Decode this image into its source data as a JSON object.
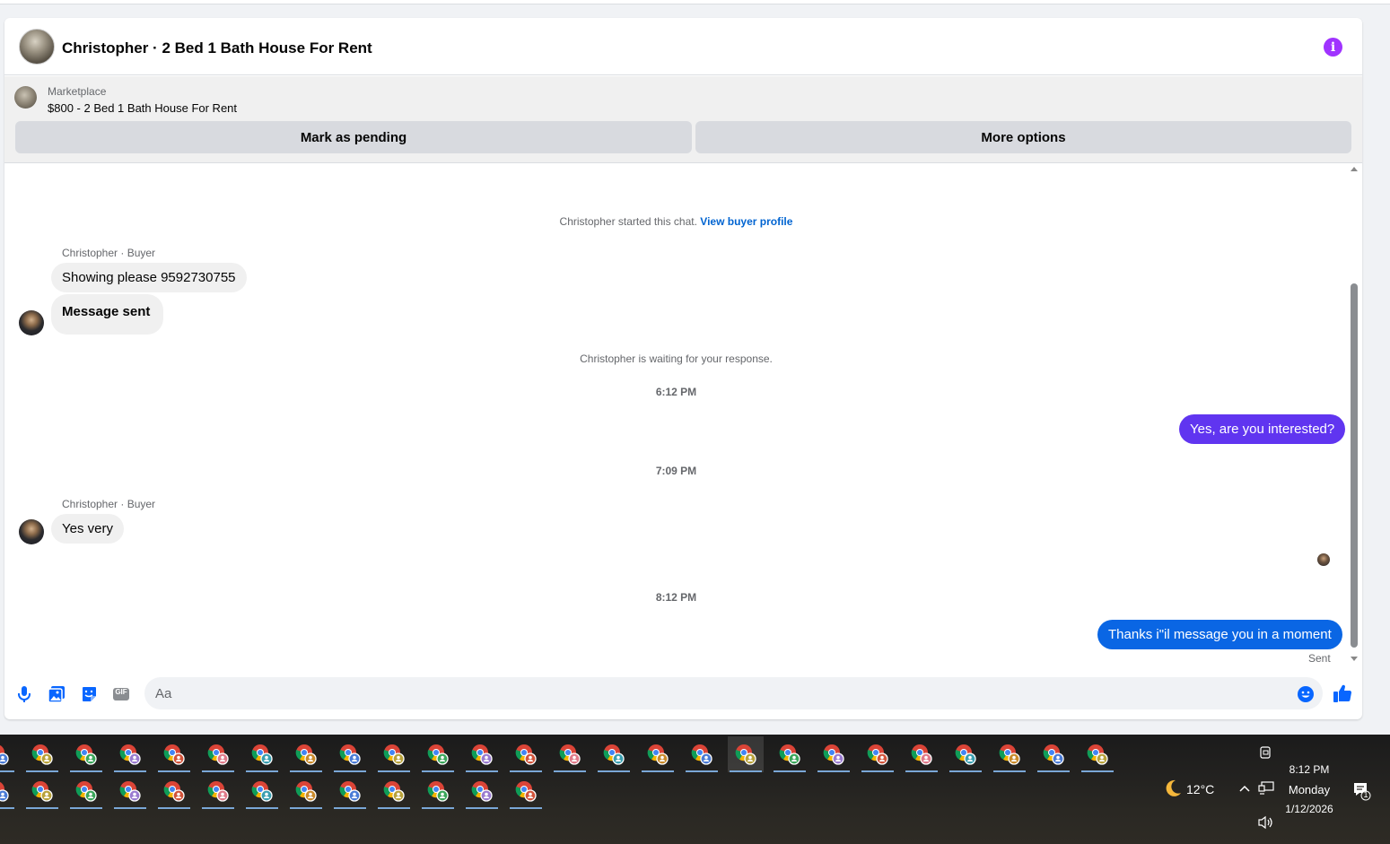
{
  "chat": {
    "title": "Christopher · 2 Bed 1 Bath House For Rent",
    "marketplace_label": "Marketplace",
    "listing": "$800 - 2 Bed 1 Bath House For Rent",
    "mark_pending": "Mark as pending",
    "more_options": "More options",
    "started_text": "Christopher started this chat.",
    "view_profile": "View buyer profile",
    "waiting_text": "Christopher is waiting for your response.",
    "sender_label": "Christopher · Buyer",
    "msg1": "Showing please 9592730755",
    "msg2": "Message sent",
    "time1": "6:12 PM",
    "reply1": "Yes, are you interested?",
    "time2": "7:09 PM",
    "msg3": "Yes very",
    "time3": "8:12 PM",
    "reply2": "Thanks i\"il message you in a moment",
    "sent_status": "Sent",
    "input_placeholder": "Aa"
  },
  "colors": {
    "reply_purple": "#6035f0",
    "reply_blue": "#0a66e4",
    "info_purple": "#a033ff",
    "icon_blue": "#0866ff"
  },
  "icons": [
    "info-icon",
    "microphone-icon",
    "photo-icon",
    "sticker-icon",
    "gif-icon",
    "emoji-icon",
    "like-icon",
    "chrome-icon",
    "moon-icon",
    "chevron-up-icon",
    "network-icon",
    "volume-icon",
    "notification-icon",
    "meet-now-icon"
  ],
  "taskbar": {
    "weather_temp": "12°C",
    "time": "8:12 PM",
    "day": "Monday",
    "date": "1/12/2026",
    "notification_count": "1",
    "gif_label": "GIF"
  }
}
